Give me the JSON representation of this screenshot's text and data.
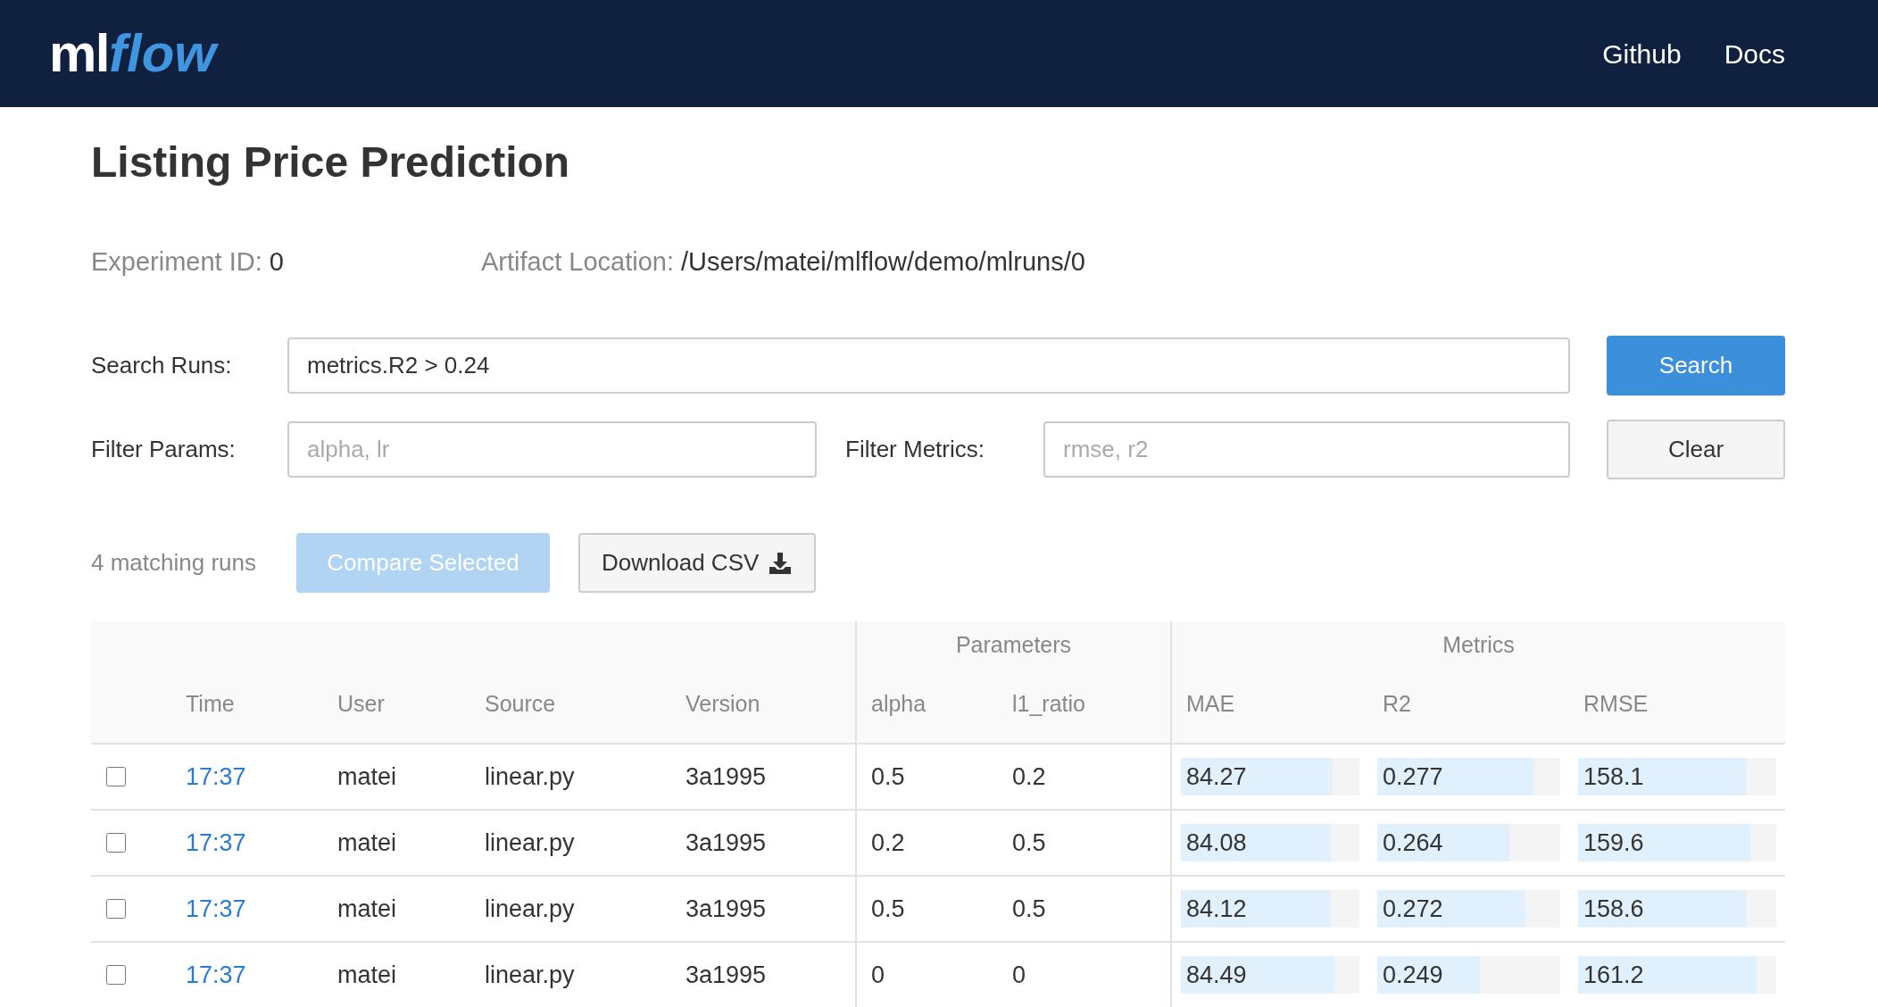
{
  "header": {
    "logo": {
      "prefix": "ml",
      "suffix": "flow"
    },
    "nav_links": [
      "Github",
      "Docs"
    ]
  },
  "title": "Listing Price Prediction",
  "info": [
    {
      "label": "Experiment ID:",
      "value": "0"
    },
    {
      "label": "Artifact Location:",
      "value": "/Users/matei/mlflow/demo/mlruns/0"
    }
  ],
  "search": {
    "label": "Search Runs:",
    "value": "metrics.R2 > 0.24",
    "button": "Search"
  },
  "filters": [
    {
      "label": "Filter Params:",
      "placeholder": "alpha, lr"
    },
    {
      "label": "Filter Metrics:",
      "placeholder": "rmse, r2"
    }
  ],
  "clear_button": "Clear",
  "matching_runs": "4 matching runs",
  "compare_button": {
    "label": "Compare Selected",
    "disabled": true
  },
  "download_button": "Download CSV",
  "table": {
    "groups": [
      "Parameters",
      "Metrics"
    ],
    "columns": [
      "Time",
      "User",
      "Source",
      "Version",
      "alpha",
      "l1_ratio",
      "MAE",
      "R2",
      "RMSE"
    ],
    "rows": [
      {
        "checked": false,
        "time": "17:37",
        "user": "matei",
        "source": "linear.py",
        "version": "3a1995",
        "params": [
          "0.5",
          "0.2"
        ],
        "metrics": [
          {
            "value": "84.27",
            "level": 0.85
          },
          {
            "value": "0.277",
            "level": 0.86
          },
          {
            "value": "158.1",
            "level": 0.85
          }
        ]
      },
      {
        "checked": false,
        "time": "17:37",
        "user": "matei",
        "source": "linear.py",
        "version": "3a1995",
        "params": [
          "0.2",
          "0.5"
        ],
        "metrics": [
          {
            "value": "84.08",
            "level": 0.84
          },
          {
            "value": "0.264",
            "level": 0.72
          },
          {
            "value": "159.6",
            "level": 0.87
          }
        ]
      },
      {
        "checked": false,
        "time": "17:37",
        "user": "matei",
        "source": "linear.py",
        "version": "3a1995",
        "params": [
          "0.5",
          "0.5"
        ],
        "metrics": [
          {
            "value": "84.12",
            "level": 0.84
          },
          {
            "value": "0.272",
            "level": 0.81
          },
          {
            "value": "158.6",
            "level": 0.85
          }
        ]
      },
      {
        "checked": false,
        "time": "17:37",
        "user": "matei",
        "source": "linear.py",
        "version": "3a1995",
        "params": [
          "0",
          "0"
        ],
        "metrics": [
          {
            "value": "84.49",
            "level": 0.86
          },
          {
            "value": "0.249",
            "level": 0.56
          },
          {
            "value": "161.2",
            "level": 0.9
          }
        ]
      }
    ]
  }
}
